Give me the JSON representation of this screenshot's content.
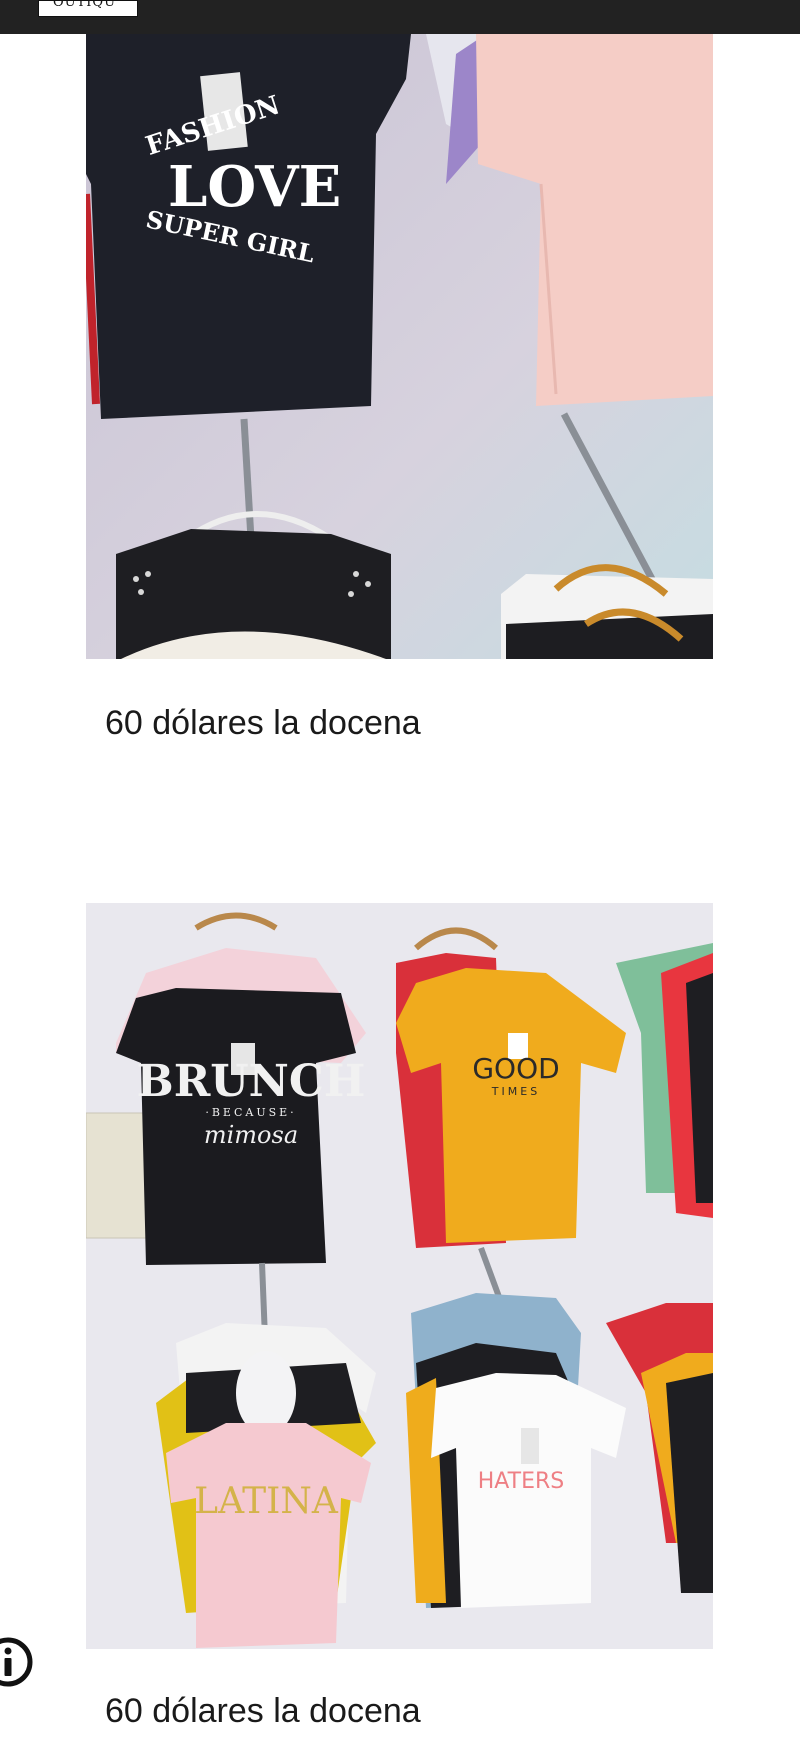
{
  "header": {
    "logo_text": "OUTIQU"
  },
  "products": [
    {
      "caption": "60 dólares la docena",
      "shirt_prints": [
        "FASHION",
        "LOVE",
        "SUPER GIRL"
      ]
    },
    {
      "caption": "60 dólares la docena",
      "shirt_prints": [
        "BRUNCH",
        "·BECAUSE·",
        "mimosa",
        "GOOD",
        "TIMES",
        "LATINA",
        "HATERS"
      ]
    }
  ],
  "icons": {
    "info": "info-icon"
  },
  "colors": {
    "topbar": "#222222",
    "caption_text": "#1a1a1a"
  }
}
